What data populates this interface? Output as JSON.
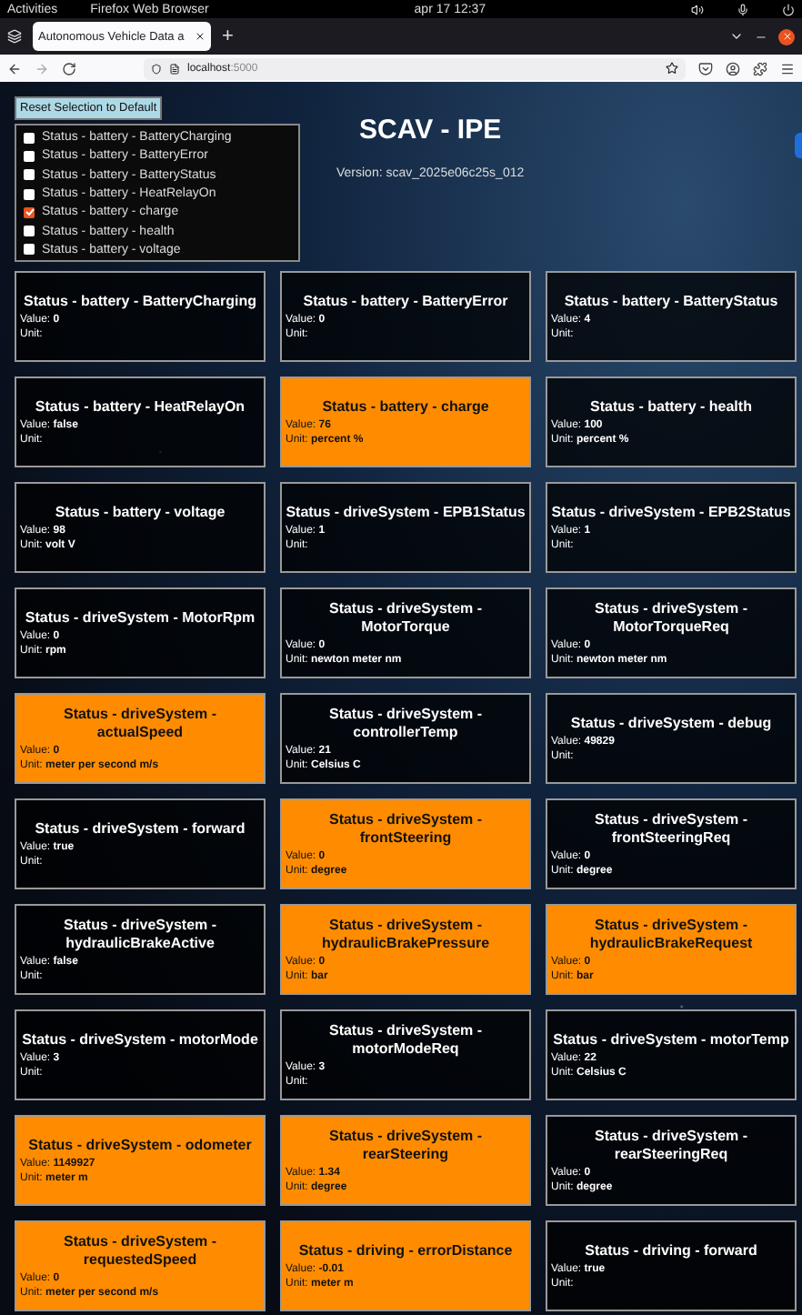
{
  "topbar": {
    "activities": "Activities",
    "app_menu": "Firefox Web Browser",
    "clock": "apr 17  12:37"
  },
  "tab": {
    "title": "Autonomous Vehicle Data a",
    "new_tab": "+"
  },
  "address": {
    "host": "localhost",
    "port": ":5000"
  },
  "reset_button": "Reset Selection to Default",
  "checklist": [
    {
      "label": "Status - battery - BatteryCharging",
      "checked": false
    },
    {
      "label": "Status - battery - BatteryError",
      "checked": false
    },
    {
      "label": "Status - battery - BatteryStatus",
      "checked": false
    },
    {
      "label": "Status - battery - HeatRelayOn",
      "checked": false
    },
    {
      "label": "Status - battery - charge",
      "checked": true
    },
    {
      "label": "Status - battery - health",
      "checked": false
    },
    {
      "label": "Status - battery - voltage",
      "checked": false
    }
  ],
  "title": "SCAV - IPE",
  "version": "Version: scav_2025e06c25s_012",
  "cards": [
    {
      "title": "Status - battery - BatteryCharging",
      "value": "Value: **0**",
      "unit": "Unit:",
      "highlighted": false
    },
    {
      "title": "Status - battery - BatteryError",
      "value": "Value: **0**",
      "unit": "Unit:",
      "highlighted": false
    },
    {
      "title": "Status - battery - BatteryStatus",
      "value": "Value: **4**",
      "unit": "Unit:",
      "highlighted": false
    },
    {
      "title": "Status - battery - HeatRelayOn",
      "value": "Value: **false**",
      "unit": "Unit:",
      "highlighted": false
    },
    {
      "title": "Status - battery - charge",
      "value": "Value: **76**",
      "unit": "Unit: **percent %**",
      "highlighted": true
    },
    {
      "title": "Status - battery - health",
      "value": "Value: **100**",
      "unit": "Unit: **percent %**",
      "highlighted": false
    },
    {
      "title": "Status - battery - voltage",
      "value": "Value: **98**",
      "unit": "Unit: **volt V**",
      "highlighted": false
    },
    {
      "title": "Status - driveSystem - EPB1Status",
      "value": "Value: **1**",
      "unit": "Unit:",
      "highlighted": false
    },
    {
      "title": "Status - driveSystem - EPB2Status",
      "value": "Value: **1**",
      "unit": "Unit:",
      "highlighted": false
    },
    {
      "title": "Status - driveSystem - MotorRpm",
      "value": "Value: **0**",
      "unit": "Unit: **rpm**",
      "highlighted": false
    },
    {
      "title": "Status - driveSystem - MotorTorque",
      "value": "Value: **0**",
      "unit": "Unit: **newton meter nm**",
      "highlighted": false
    },
    {
      "title": "Status - driveSystem - MotorTorqueReq",
      "value": "Value: **0**",
      "unit": "Unit: **newton meter nm**",
      "highlighted": false
    },
    {
      "title": "Status - driveSystem - actualSpeed",
      "value": "Value: **0**",
      "unit": "Unit: **meter per second m/s**",
      "highlighted": true
    },
    {
      "title": "Status - driveSystem - controllerTemp",
      "value": "Value: **21**",
      "unit": "Unit: **Celsius C**",
      "highlighted": false
    },
    {
      "title": "Status - driveSystem - debug",
      "value": "Value: **49829**",
      "unit": "Unit:",
      "highlighted": false
    },
    {
      "title": "Status - driveSystem - forward",
      "value": "Value: **true**",
      "unit": "Unit:",
      "highlighted": false
    },
    {
      "title": "Status - driveSystem - frontSteering",
      "value": "Value: **0**",
      "unit": "Unit: **degree**",
      "highlighted": true
    },
    {
      "title": "Status - driveSystem - frontSteeringReq",
      "value": "Value: **0**",
      "unit": "Unit: **degree**",
      "highlighted": false
    },
    {
      "title": "Status - driveSystem - hydraulicBrakeActive",
      "value": "Value: **false**",
      "unit": "Unit:",
      "highlighted": false
    },
    {
      "title": "Status - driveSystem - hydraulicBrakePressure",
      "value": "Value: **0**",
      "unit": "Unit: **bar**",
      "highlighted": true
    },
    {
      "title": "Status - driveSystem - hydraulicBrakeRequest",
      "value": "Value: **0**",
      "unit": "Unit: **bar**",
      "highlighted": true
    },
    {
      "title": "Status - driveSystem - motorMode",
      "value": "Value: **3**",
      "unit": "Unit:",
      "highlighted": false
    },
    {
      "title": "Status - driveSystem - motorModeReq",
      "value": "Value: **3**",
      "unit": "Unit:",
      "highlighted": false
    },
    {
      "title": "Status - driveSystem - motorTemp",
      "value": "Value: **22**",
      "unit": "Unit: **Celsius C**",
      "highlighted": false
    },
    {
      "title": "Status - driveSystem - odometer",
      "value": "Value: **1149927**",
      "unit": "Unit: **meter m**",
      "highlighted": true
    },
    {
      "title": "Status - driveSystem - rearSteering",
      "value": "Value: **1.34**",
      "unit": "Unit: **degree**",
      "highlighted": true
    },
    {
      "title": "Status - driveSystem - rearSteeringReq",
      "value": "Value: **0**",
      "unit": "Unit: **degree**",
      "highlighted": false
    },
    {
      "title": "Status - driveSystem - requestedSpeed",
      "value": "Value: **0**",
      "unit": "Unit: **meter per second m/s**",
      "highlighted": true
    },
    {
      "title": "Status - driving - errorDistance",
      "value": "Value: **-0.01**",
      "unit": "Unit: **meter m**",
      "highlighted": true
    },
    {
      "title": "Status - driving - forward",
      "value": "Value: **true**",
      "unit": "Unit:",
      "highlighted": false
    }
  ]
}
